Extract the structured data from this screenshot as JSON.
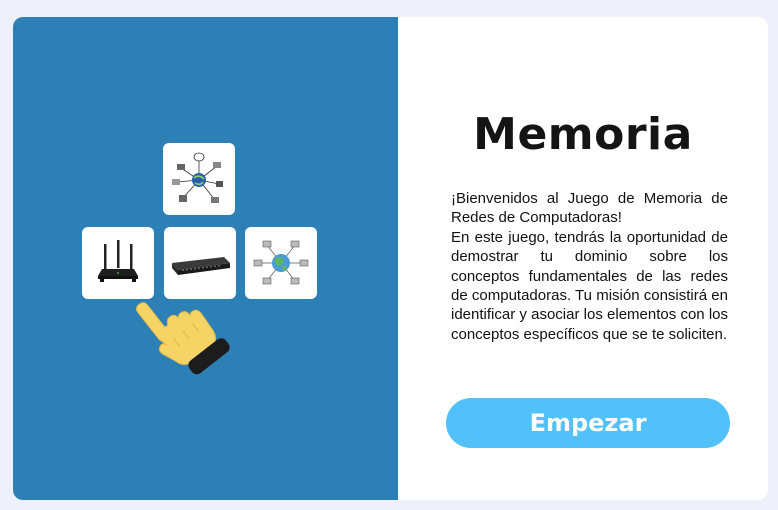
{
  "game": {
    "title": "Memoria",
    "intro_line": "¡Bienvenidos al Juego de Memoria de Redes de Computadoras!",
    "description": "En este juego, tendrás la oportunidad de demostrar tu dominio sobre los conceptos fundamentales de las redes de computadoras. Tu misión consistirá en identificar y asociar los elementos con los conceptos específicos que se te soliciten.",
    "start_button_label": "Empezar"
  },
  "illustration": {
    "cards": [
      {
        "icon": "network-diagram-icon"
      },
      {
        "icon": "wifi-router-icon"
      },
      {
        "icon": "network-switch-icon"
      },
      {
        "icon": "globe-network-icon"
      }
    ],
    "pointer_icon": "pointing-hand-icon"
  },
  "colors": {
    "page_background": "#eef1fb",
    "left_panel": "#2d80b5",
    "button": "#53c1f9",
    "hand": "#f6d365",
    "cuff": "#1c1c1c"
  }
}
